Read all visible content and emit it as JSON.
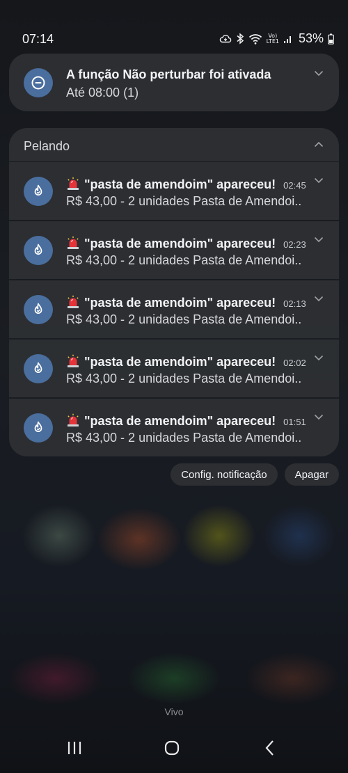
{
  "status_bar": {
    "time": "07:14",
    "battery": "53%",
    "icons": [
      "cloud-sync-icon",
      "bluetooth-icon",
      "wifi-icon",
      "volte-icon",
      "signal-icon",
      "battery-icon"
    ],
    "volte_label_top": "Vo)",
    "volte_label_bottom": "LTE1"
  },
  "dnd": {
    "icon": "do-not-disturb-icon",
    "title": "A função Não perturbar foi ativada",
    "subtitle": "Até 08:00 (1)"
  },
  "group": {
    "app_name": "Pelando",
    "icon": "pelando-flame-icon",
    "notifications": [
      {
        "title": "\"pasta de amendoim\" apareceu!",
        "time": "02:45",
        "body": "R$ 43,00 - 2 unidades Pasta de Amendoi.."
      },
      {
        "title": "\"pasta de amendoim\" apareceu!",
        "time": "02:23",
        "body": "R$ 43,00 - 2 unidades Pasta de Amendoi.."
      },
      {
        "title": "\"pasta de amendoim\" apareceu!",
        "time": "02:13",
        "body": "R$ 43,00 - 2 unidades Pasta de Amendoi.."
      },
      {
        "title": "\"pasta de amendoim\" apareceu!",
        "time": "02:02",
        "body": "R$ 43,00 - 2 unidades Pasta de Amendoi.."
      },
      {
        "title": "\"pasta de amendoim\" apareceu!",
        "time": "01:51",
        "body": "R$ 43,00 - 2 unidades Pasta de Amendoi.."
      }
    ]
  },
  "actions": {
    "settings_label": "Config. notificação",
    "clear_label": "Apagar"
  },
  "carrier": "Vivo",
  "navbar": {
    "recents": "recents-icon",
    "home": "home-icon",
    "back": "back-icon"
  },
  "colors": {
    "card_bg": "#2d2f33",
    "icon_blue": "#4a6e9e",
    "siren_red": "#e5333a"
  }
}
